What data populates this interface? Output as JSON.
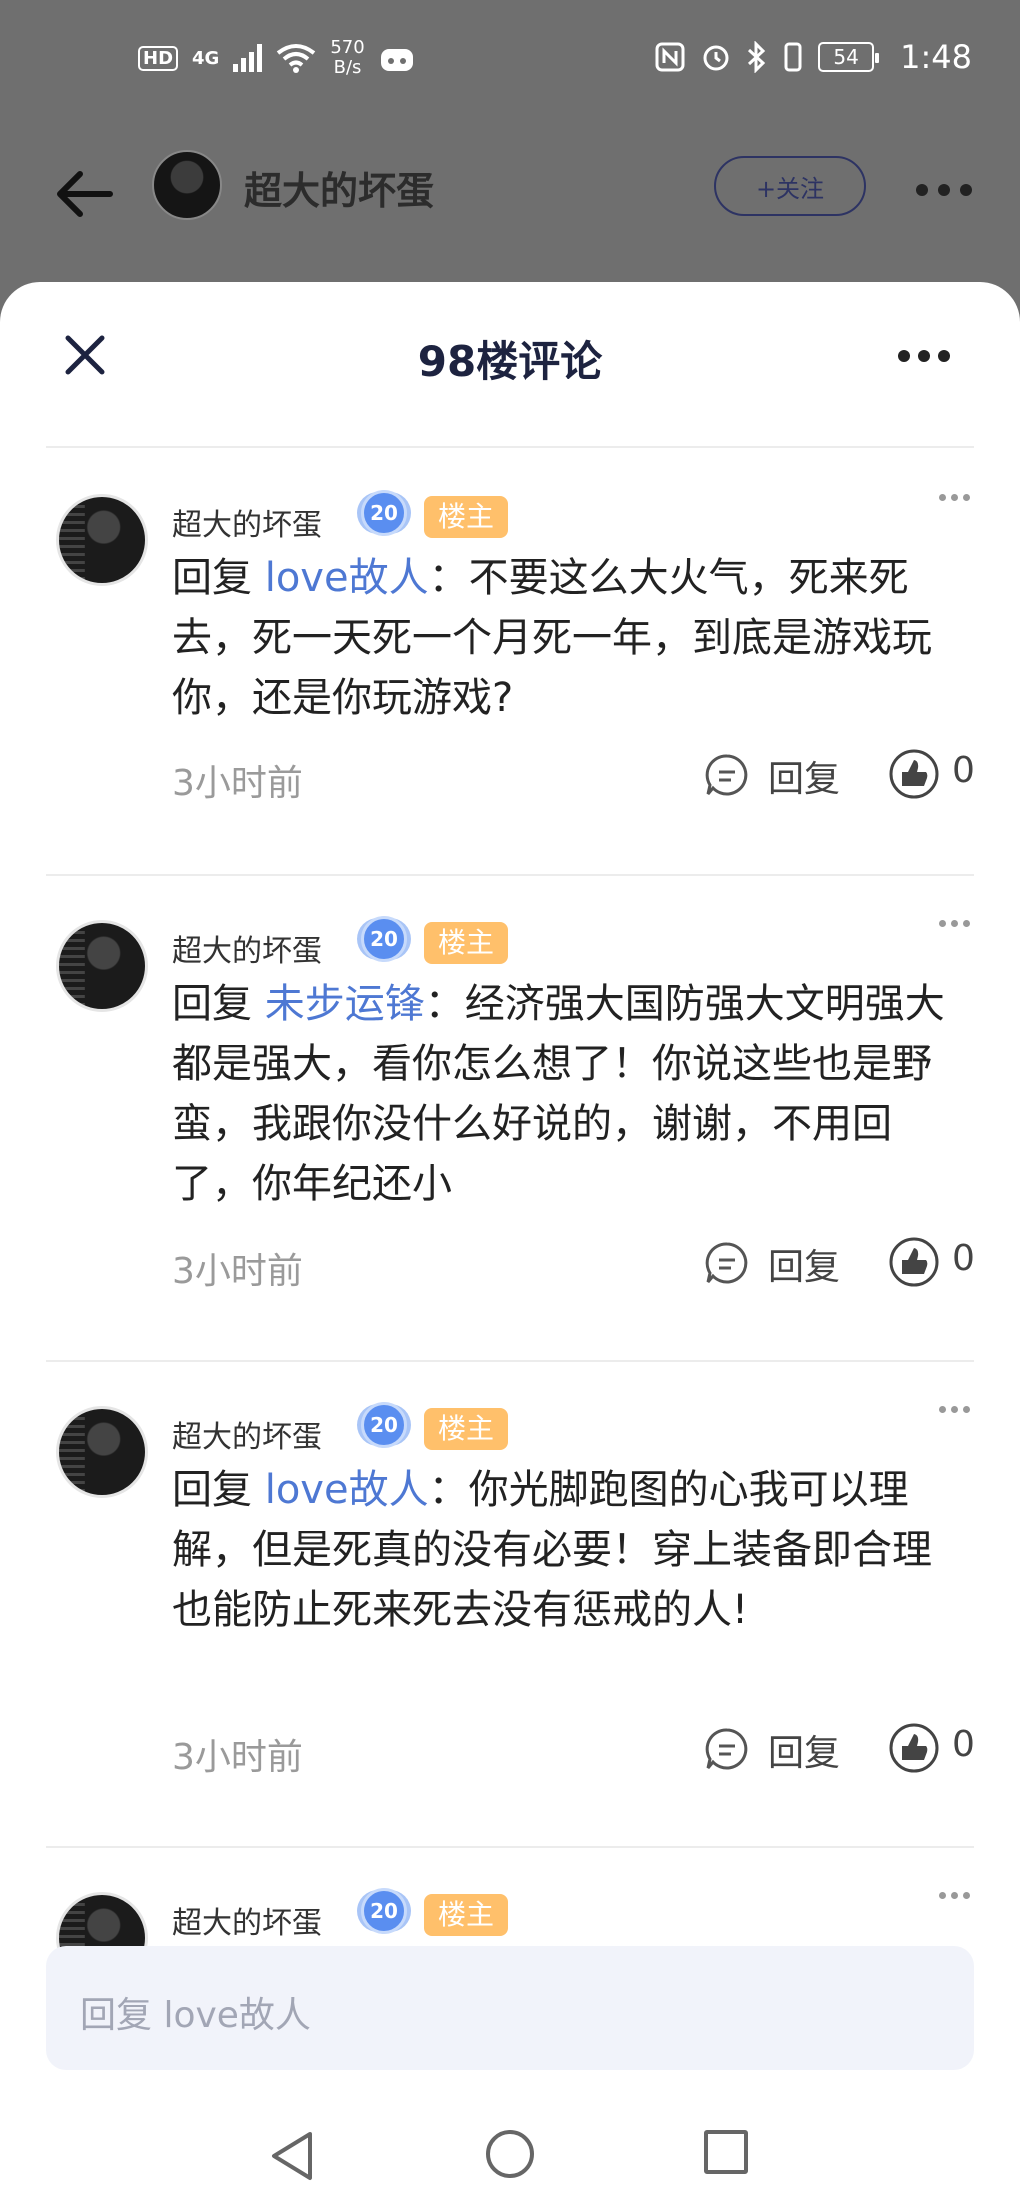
{
  "status_bar": {
    "hd": "HD",
    "network": "4G",
    "speed_value": "570",
    "speed_unit": "B/s",
    "battery": "54",
    "time": "1:48"
  },
  "header": {
    "username": "超大的坏蛋",
    "follow_label": "+关注"
  },
  "sheet": {
    "title": "98楼评论"
  },
  "comments": [
    {
      "user": "超大的坏蛋",
      "level": "20",
      "badge": "楼主",
      "reply_prefix": "回复 ",
      "reply_target": "love故人",
      "text": "：不要这么大火气，死来死去，死一天死一个月死一年，到底是游戏玩你，还是你玩游戏?",
      "time": "3小时前",
      "reply_label": "回复",
      "likes": "0"
    },
    {
      "user": "超大的坏蛋",
      "level": "20",
      "badge": "楼主",
      "reply_prefix": "回复 ",
      "reply_target": "未步运锋",
      "text": "：经济强大国防强大文明强大都是强大，看你怎么想了！你说这些也是野蛮，我跟你没什么好说的，谢谢，不用回了，你年纪还小",
      "time": "3小时前",
      "reply_label": "回复",
      "likes": "0"
    },
    {
      "user": "超大的坏蛋",
      "level": "20",
      "badge": "楼主",
      "reply_prefix": "回复 ",
      "reply_target": "love故人",
      "text": "：你光脚跑图的心我可以理解，但是死真的没有必要！穿上装备即合理也能防止死来死去没有惩戒的人!",
      "time": "3小时前",
      "reply_label": "回复",
      "likes": "0"
    },
    {
      "user": "超大的坏蛋",
      "level": "20",
      "badge": "楼主"
    }
  ],
  "input": {
    "placeholder": "回复 love故人"
  }
}
